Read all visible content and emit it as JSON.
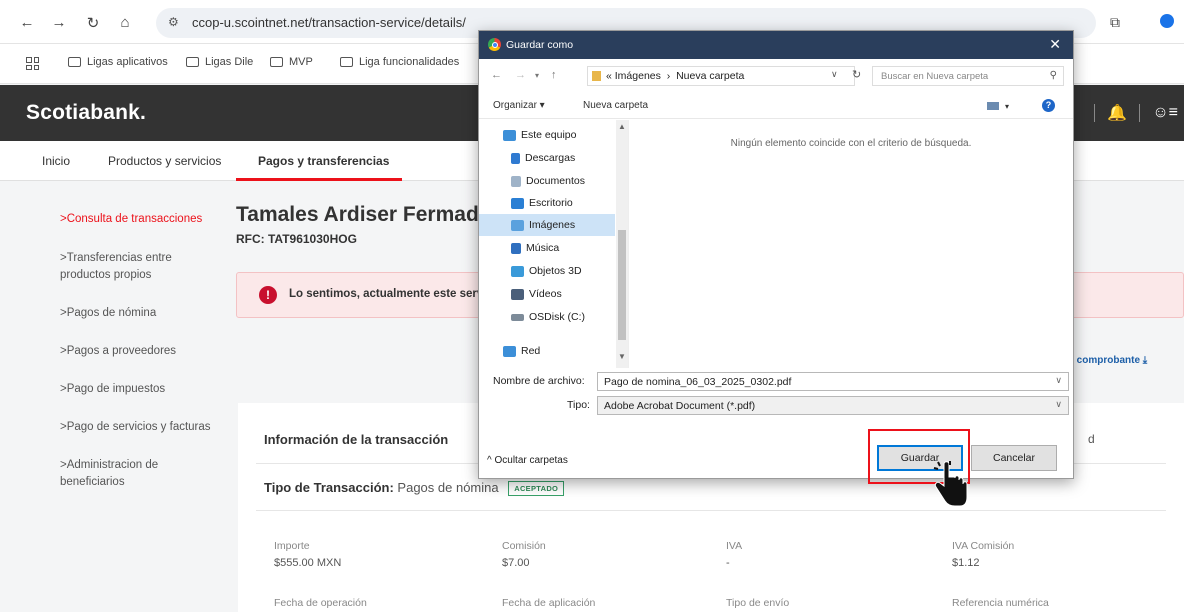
{
  "browser": {
    "url": "ccop-u.scointnet.net/transaction-service/details/",
    "bookmarks": [
      "Ligas aplicativos",
      "Ligas Dile",
      "MVP",
      "Liga funcionalidades"
    ]
  },
  "app": {
    "brand": "Scotiabank.",
    "nav_tabs": [
      "Inicio",
      "Productos y servicios",
      "Pagos y transferencias"
    ],
    "sidebar": [
      ">Consulta de transacciones",
      ">Transferencias entre productos propios",
      ">Pagos de nómina",
      ">Pagos a proveedores",
      ">Pago de impuestos",
      ">Pago de servicios y facturas",
      ">Administracion de beneficiarios"
    ],
    "company_name": "Tamales Ardiser Fermad",
    "rfc": "RFC: TAT961030HOG",
    "alert_text": "Lo sentimos, actualmente este serv",
    "receipt_link": "r comprobante",
    "card": {
      "title": "Información de la transacción",
      "right_fragment": "d",
      "type_label": "Tipo de Transacción:",
      "type_value": "Pagos de nómina",
      "status_badge": "ACEPTADO",
      "fields": [
        {
          "label": "Importe",
          "value": "$555.00 MXN"
        },
        {
          "label": "Comisión",
          "value": "$7.00"
        },
        {
          "label": "IVA",
          "value": "-"
        },
        {
          "label": "IVA Comisión",
          "value": "$1.12"
        }
      ],
      "fields_row2": [
        "Fecha de operación",
        "Fecha de aplicación",
        "Tipo de envío",
        "Referencia numérica"
      ]
    }
  },
  "dialog": {
    "title": "Guardar como",
    "path": [
      "Imágenes",
      "Nueva carpeta"
    ],
    "search_placeholder": "Buscar en Nueva carpeta",
    "organize": "Organizar ▾",
    "new_folder": "Nueva carpeta",
    "tree": [
      {
        "label": "Este equipo",
        "color": "#3c8fd8"
      },
      {
        "label": "Descargas",
        "color": "#2f7ad1"
      },
      {
        "label": "Documentos",
        "color": "#9fb3c8"
      },
      {
        "label": "Escritorio",
        "color": "#2a7fd4"
      },
      {
        "label": "Imágenes",
        "color": "#5aa1de",
        "selected": true
      },
      {
        "label": "Música",
        "color": "#2f6fbf"
      },
      {
        "label": "Objetos 3D",
        "color": "#3a9ad9"
      },
      {
        "label": "Vídeos",
        "color": "#4a5f7a"
      },
      {
        "label": "OSDisk (C:)",
        "color": "#7d8b99"
      },
      {
        "label": "Red",
        "color": "#3c8fd8"
      }
    ],
    "empty_message": "Ningún elemento coincide con el criterio de búsqueda.",
    "filename_label": "Nombre de archivo:",
    "filename": "Pago de nomina_06_03_2025_0302.pdf",
    "type_label": "Tipo:",
    "file_type": "Adobe Acrobat Document (*.pdf)",
    "hide_folders": "Ocultar carpetas",
    "save_button": "Guardar",
    "cancel_button": "Cancelar"
  }
}
